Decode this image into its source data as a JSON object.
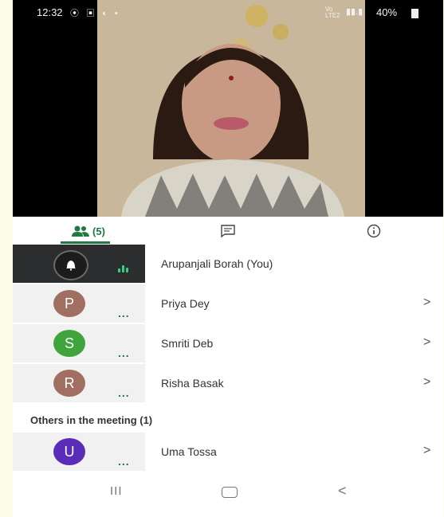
{
  "status_bar": {
    "time": "12:32",
    "icons": "⦿ ▣ ◐ •",
    "network": "Vo LTE2",
    "signal": "▮▮.▮",
    "battery": "40%"
  },
  "tabs": {
    "people_count": "(5)",
    "active": "people"
  },
  "participants": [
    {
      "name": "Arupanjali Borah (You)",
      "initial": "",
      "color": "#1c1c1c",
      "is_self": true
    },
    {
      "name": "Priya Dey",
      "initial": "P",
      "color": "#a06f62"
    },
    {
      "name": "Smriti Deb",
      "initial": "S",
      "color": "#3ea43b"
    },
    {
      "name": "Risha Basak",
      "initial": "R",
      "color": "#a06f62"
    }
  ],
  "others_heading": "Others in the meeting (1)",
  "others": [
    {
      "name": "Uma Tossa",
      "initial": "U",
      "color": "#5a2db8"
    }
  ],
  "row_dots": "...",
  "chevron": ">",
  "navbar": {
    "recent": "III",
    "back": "<"
  }
}
